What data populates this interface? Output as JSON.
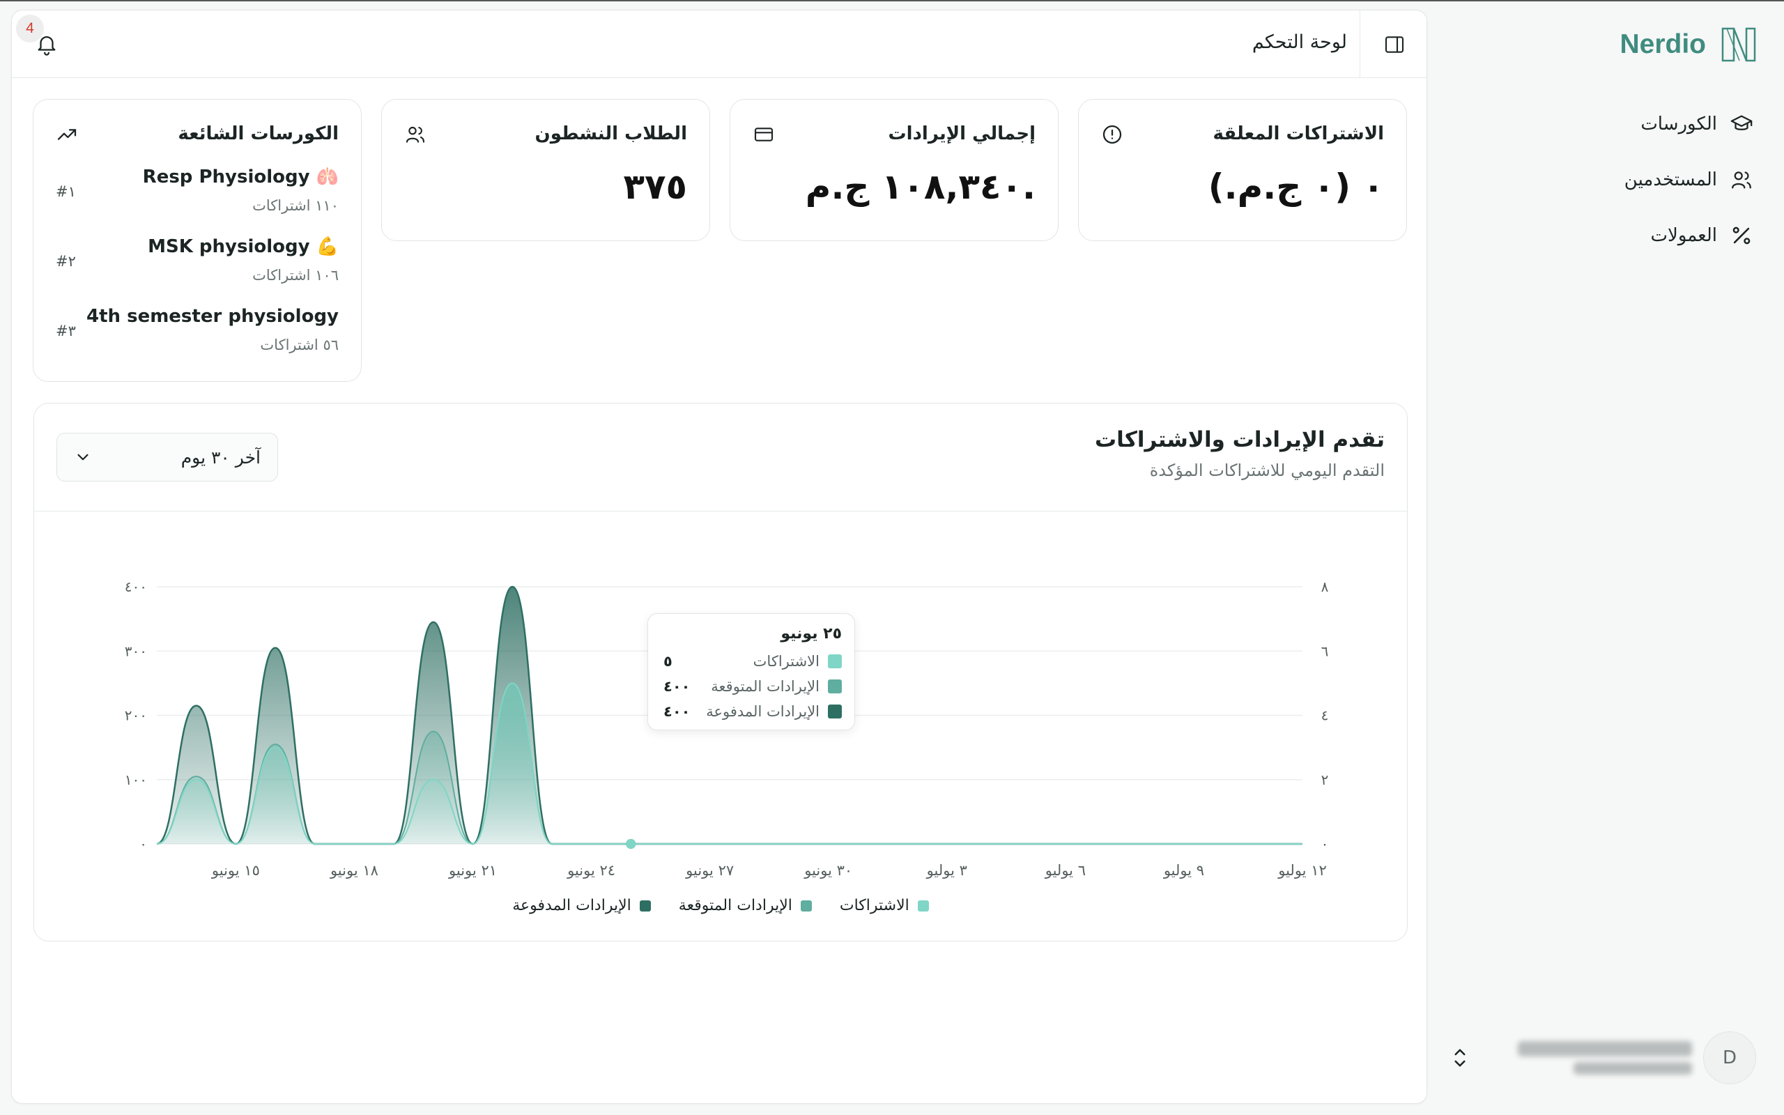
{
  "brand": {
    "name": "Nerdio"
  },
  "sidebar": {
    "items": [
      {
        "label": "الكورسات",
        "icon": "graduation-cap-icon"
      },
      {
        "label": "المستخدمين",
        "icon": "users-icon"
      },
      {
        "label": "العمولات",
        "icon": "percent-icon"
      }
    ],
    "user": {
      "avatar_initial": "D"
    }
  },
  "header": {
    "title": "لوحة التحكم",
    "notification_count": "4"
  },
  "stats": [
    {
      "title": "الاشتراكات المعلقة",
      "value": "٠ (٠ ج.م.)",
      "icon": "alert-circle-icon"
    },
    {
      "title": "إجمالي الإيرادات",
      "value": "١٠٨,٣٤٠ ج.م.",
      "icon": "credit-card-icon"
    },
    {
      "title": "الطلاب النشطون",
      "value": "٣٧٥",
      "icon": "users-icon"
    }
  ],
  "popular": {
    "title": "الكورسات الشائعة",
    "icon": "trending-up-icon",
    "items": [
      {
        "name": "Resp Physiology 🫁",
        "subs": "١١٠ اشتراكات",
        "rank": "#١"
      },
      {
        "name": "MSK physiology 💪",
        "subs": "١٠٦ اشتراكات",
        "rank": "#٢"
      },
      {
        "name": "4th semester physiology",
        "subs": "٥٦ اشتراكات",
        "rank": "#٣"
      }
    ]
  },
  "chart": {
    "title": "تقدم الإيرادات والاشتراكات",
    "subtitle": "التقدم اليومي للاشتراكات المؤكدة",
    "range": "آخر ٣٠ يوم",
    "tooltip": {
      "title": "٢٥ يونيو",
      "rows": [
        {
          "label": "الاشتراكات",
          "value": "٥"
        },
        {
          "label": "الإيرادات المتوقعة",
          "value": "٤٠٠"
        },
        {
          "label": "الإيرادات المدفوعة",
          "value": "٤٠٠"
        }
      ]
    }
  },
  "chart_data": {
    "type": "area",
    "x": [
      "١٣ يونيو",
      "١٤ يونيو",
      "١٥ يونيو",
      "١٦ يونيو",
      "١٧ يونيو",
      "١٨ يونيو",
      "١٩ يونيو",
      "٢٠ يونيو",
      "٢١ يونيو",
      "٢٢ يونيو",
      "٢٣ يونيو",
      "٢٤ يونيو",
      "٢٥ يونيو",
      "٢٦ يونيو",
      "٢٧ يونيو",
      "٢٨ يونيو",
      "٢٩ يونيو",
      "٣٠ يونيو",
      "١ يوليو",
      "٢ يوليو",
      "٣ يوليو",
      "٤ يوليو",
      "٥ يوليو",
      "٦ يوليو",
      "٧ يوليو",
      "٨ يوليو",
      "٩ يوليو",
      "١٠ يوليو",
      "١١ يوليو",
      "١٢ يوليو"
    ],
    "x_tick_labels": [
      "١٥ يونيو",
      "١٨ يونيو",
      "٢١ يونيو",
      "٢٤ يونيو",
      "٢٧ يونيو",
      "٣٠ يونيو",
      "٣ يوليو",
      "٦ يوليو",
      "٩ يوليو",
      "١٢ يوليو"
    ],
    "y_left_ticks": [
      "٠",
      "١٠٠",
      "٢٠٠",
      "٣٠٠",
      "٤٠٠"
    ],
    "y_right_ticks": [
      "٠",
      "٢",
      "٤",
      "٦",
      "٨"
    ],
    "ylim_left": [
      0,
      400
    ],
    "ylim_right": [
      0,
      8
    ],
    "series": [
      {
        "name": "الاشتراكات",
        "color": "#7fd6c6",
        "values": [
          0,
          2,
          0,
          3,
          0,
          0,
          0,
          2,
          0,
          5,
          0,
          0,
          0,
          0,
          0,
          0,
          0,
          0,
          0,
          0,
          0,
          0,
          0,
          0,
          0,
          0,
          0,
          0,
          0,
          0
        ]
      },
      {
        "name": "الإيرادات المتوقعة",
        "color": "#5fae9f",
        "values": [
          0,
          105,
          0,
          155,
          0,
          0,
          0,
          175,
          0,
          250,
          0,
          0,
          0,
          0,
          0,
          0,
          0,
          0,
          0,
          0,
          0,
          0,
          0,
          0,
          0,
          0,
          0,
          0,
          0,
          0
        ]
      },
      {
        "name": "الإيرادات المدفوعة",
        "color": "#2e6f63",
        "values": [
          0,
          215,
          0,
          305,
          0,
          0,
          0,
          345,
          0,
          400,
          0,
          0,
          0,
          0,
          0,
          0,
          0,
          0,
          0,
          0,
          0,
          0,
          0,
          0,
          0,
          0,
          0,
          0,
          0,
          0
        ]
      }
    ],
    "grid": true,
    "legend": "bottom"
  }
}
